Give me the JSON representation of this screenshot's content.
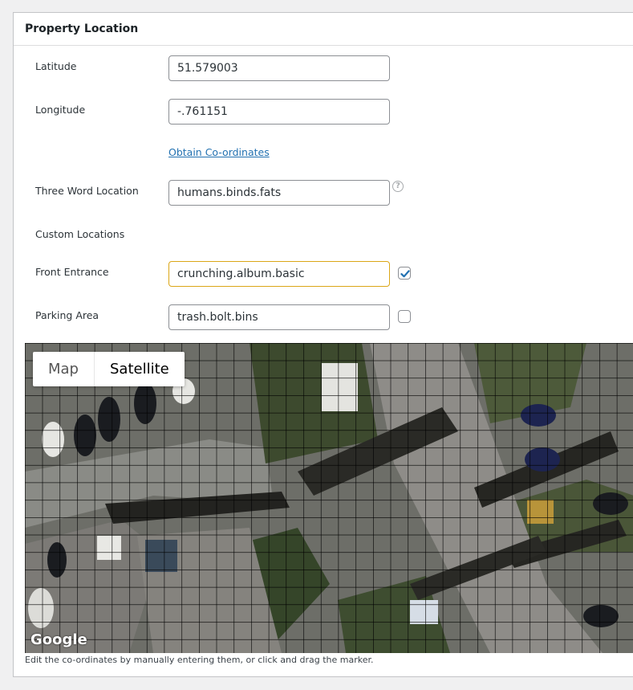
{
  "panel": {
    "title": "Property Location"
  },
  "fields": {
    "latitude": {
      "label": "Latitude",
      "value": "51.579003"
    },
    "longitude": {
      "label": "Longitude",
      "value": "-.761151"
    },
    "obtain_link": "Obtain Co-ordinates",
    "three_word": {
      "label": "Three Word Location",
      "value": "humans.binds.fats",
      "help_icon": "help-circle-icon"
    },
    "custom_heading": "Custom Locations",
    "front_entrance": {
      "label": "Front Entrance",
      "value": "crunching.album.basic",
      "checked": true
    },
    "parking_area": {
      "label": "Parking Area",
      "value": "trash.bolt.bins",
      "checked": false
    }
  },
  "map": {
    "type_control": {
      "map_label": "Map",
      "satellite_label": "Satellite",
      "selected": "Satellite"
    },
    "attribution": "Google"
  },
  "caption": "Edit the co-ordinates by manually entering them, or click and drag the marker.",
  "colors": {
    "link": "#2271b1",
    "focus_border": "#dba617",
    "checkbox_check": "#2271b1"
  }
}
